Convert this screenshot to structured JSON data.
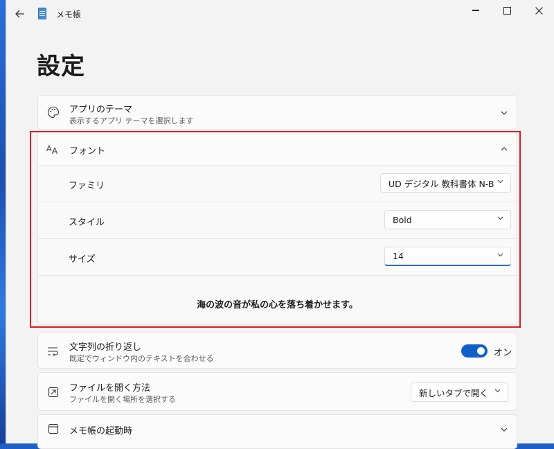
{
  "window": {
    "title": "メモ帳"
  },
  "page": {
    "title": "設定"
  },
  "theme": {
    "title": "アプリのテーマ",
    "subtitle": "表示するアプリ テーマを選択します"
  },
  "font": {
    "title": "フォント",
    "family_label": "ファミリ",
    "family_value": "UD デジタル 教科書体 N-B",
    "style_label": "スタイル",
    "style_value": "Bold",
    "size_label": "サイズ",
    "size_value": "14",
    "preview_text": "海の波の音が私の心を落ち着かせます。"
  },
  "wrap": {
    "title": "文字列の折り返し",
    "subtitle": "既定でウィンドウ内のテキストを合わせる",
    "toggle_label": "オン",
    "enabled": true
  },
  "open_file": {
    "title": "ファイルを開く方法",
    "subtitle": "ファイルを開く場所を選択する",
    "value": "新しいタブで開く"
  },
  "startup": {
    "title": "メモ帳の起動時"
  },
  "colors": {
    "accent": "#0f61c9",
    "highlight": "#e0191f"
  }
}
